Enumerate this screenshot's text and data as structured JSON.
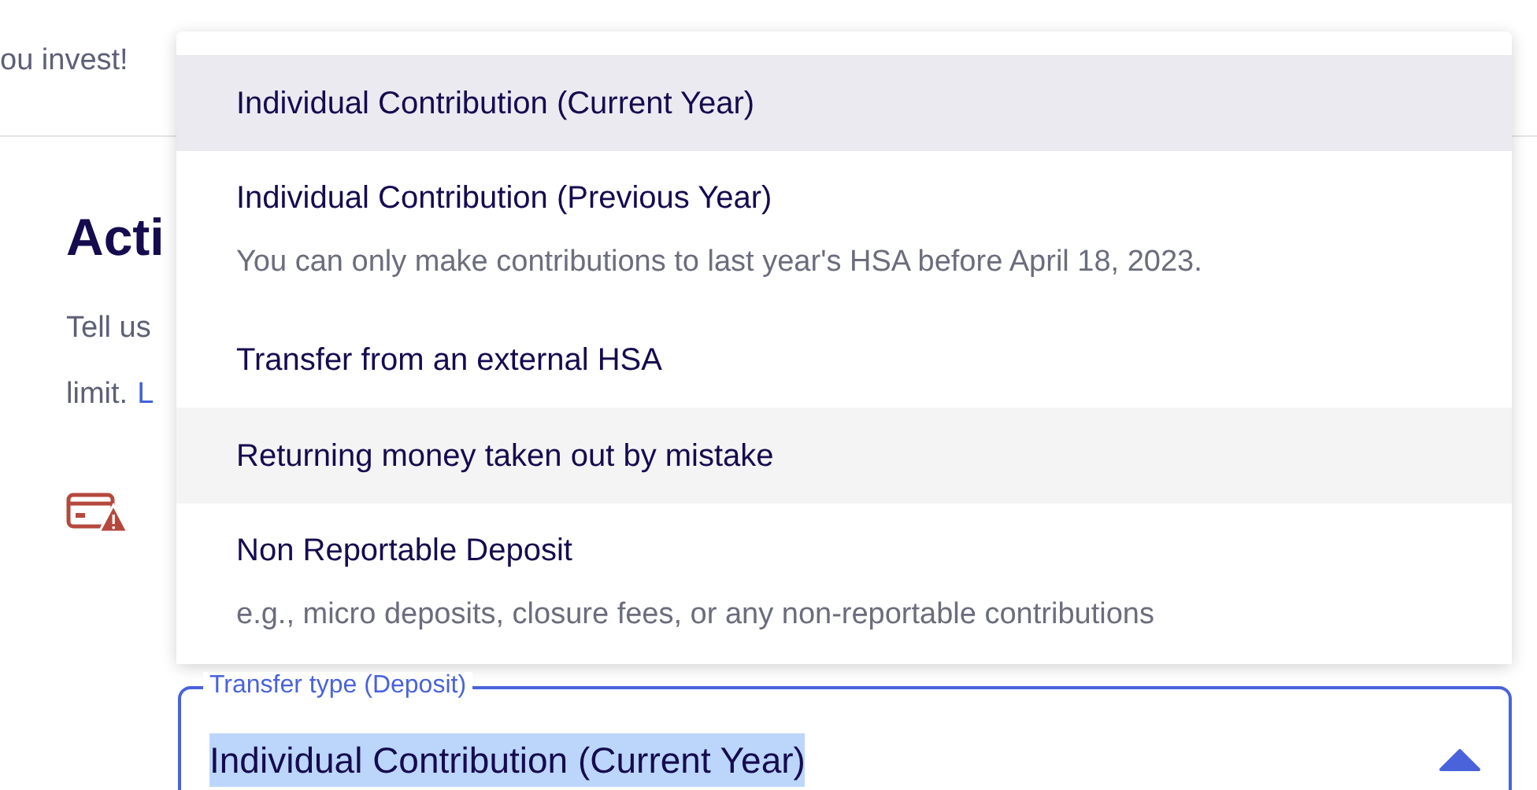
{
  "intro_text": "ou invest!",
  "section": {
    "heading": "Acti",
    "body_line_1": "Tell us",
    "body_line_2": "limit.",
    "link": "L"
  },
  "transfer_field": {
    "label": "Transfer type (Deposit)",
    "value": "Individual Contribution (Current Year)",
    "expanded": true
  },
  "options": [
    {
      "label": "Individual Contribution (Current Year)",
      "selected": true,
      "hovered": false
    },
    {
      "label": "Individual Contribution (Previous Year)",
      "note": "You can only make contributions to last year's HSA before April 18, 2023.",
      "selected": false,
      "hovered": false
    },
    {
      "label": "Transfer from an external HSA",
      "selected": false,
      "hovered": false
    },
    {
      "label": "Returning money taken out by mistake",
      "selected": false,
      "hovered": true
    },
    {
      "label": "Non Reportable Deposit",
      "note": "e.g., micro deposits, closure fees, or any non-reportable contributions",
      "selected": false,
      "hovered": false
    }
  ]
}
